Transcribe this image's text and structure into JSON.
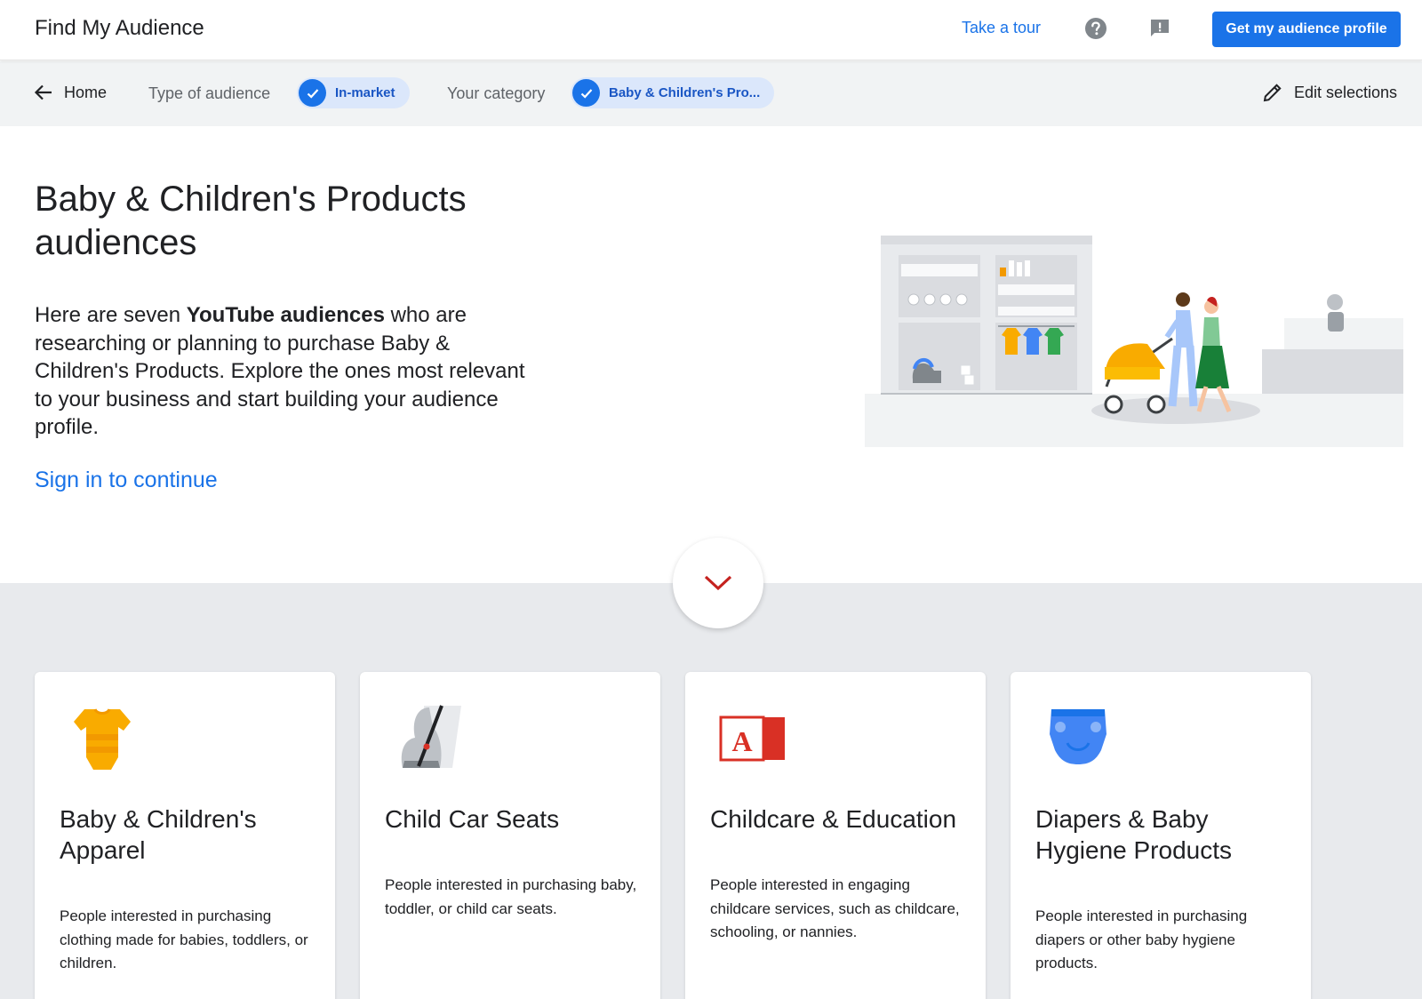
{
  "header": {
    "app_title": "Find My Audience",
    "tour_label": "Take a tour",
    "help_icon": "help-circle-icon",
    "feedback_icon": "feedback-icon",
    "cta_label": "Get my audience profile"
  },
  "selection_bar": {
    "home_label": "Home",
    "audience_type_label": "Type of audience",
    "audience_type_value": "In-market",
    "category_label": "Your category",
    "category_value": "Baby & Children's Pro...",
    "edit_label": "Edit selections"
  },
  "hero": {
    "title": "Baby & Children's Products audiences",
    "body_intro": "Here are seven ",
    "body_bold": "YouTube audiences",
    "body_rest": " who are researching or planning to purchase Baby & Children's Products. Explore the ones most relevant to your business and start building your audience profile.",
    "signin_label": "Sign in to continue"
  },
  "cards": [
    {
      "title": "Baby & Children's Apparel",
      "description": "People interested in purchasing clothing made for babies, toddlers, or children.",
      "icon": "baby-onesie-icon"
    },
    {
      "title": "Child Car Seats",
      "description": "People interested in purchasing baby, toddler, or child car seats.",
      "icon": "car-seat-icon"
    },
    {
      "title": "Childcare & Education",
      "description": "People interested in engaging childcare services, such as childcare, schooling, or nannies.",
      "icon": "alphabet-block-icon",
      "icon_letter": "A"
    },
    {
      "title": "Diapers & Baby Hygiene Products",
      "description": "People interested in purchasing diapers or other baby hygiene products.",
      "icon": "diaper-icon"
    }
  ],
  "colors": {
    "primary_blue": "#1a73e8",
    "chip_bg": "#dbe7fb",
    "scroll_chevron": "#c5221f",
    "gray_section": "#e8eaed",
    "onesie_orange": "#f9ab00",
    "diaper_blue": "#4285f4",
    "block_red": "#d93025"
  }
}
